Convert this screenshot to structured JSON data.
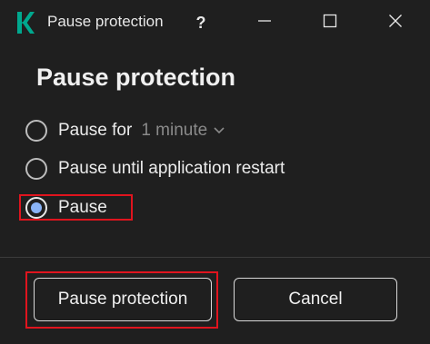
{
  "window": {
    "title": "Pause protection",
    "help_label": "?"
  },
  "icons": {
    "app": "kaspersky-logo-icon",
    "minimize": "minimize-icon",
    "maximize": "maximize-icon",
    "close": "close-icon",
    "dropdown": "chevron-down-icon"
  },
  "heading": "Pause protection",
  "options": [
    {
      "label": "Pause for",
      "checked": false
    },
    {
      "label": "Pause until application restart",
      "checked": false
    },
    {
      "label": "Pause",
      "checked": true
    }
  ],
  "duration": {
    "selected": "1 minute"
  },
  "buttons": {
    "pause_protection": "Pause protection",
    "cancel": "Cancel"
  },
  "colors": {
    "background": "#1f1f1f",
    "logo_accent": "#00a88e",
    "radio_selected": "#8ab4f8",
    "highlight": "#e0141e"
  }
}
